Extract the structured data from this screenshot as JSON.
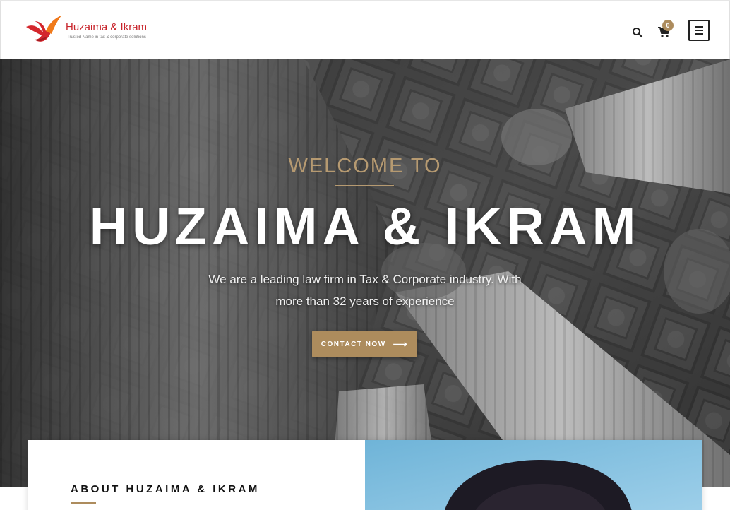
{
  "brand": {
    "name": "Huzaima & Ikram",
    "tagline": "Trusted Name in tax & corporate solutions"
  },
  "header": {
    "cart_count": "0",
    "icons": {
      "search": "search-icon",
      "cart": "cart-icon",
      "menu": "hamburger-menu-icon"
    }
  },
  "hero": {
    "welcome": "WELCOME TO",
    "title": "HUZAIMA & IKRAM",
    "description": "We are a leading law firm in Tax & Corporate industry. With more than 32 years of experience",
    "cta_label": "CONTACT NOW",
    "cta_icon": "arrow-right-icon"
  },
  "about": {
    "heading": "ABOUT HUZAIMA & IKRAM"
  },
  "colors": {
    "accent": "#ad8c5d",
    "brand_red": "#c8242b",
    "white": "#ffffff"
  }
}
